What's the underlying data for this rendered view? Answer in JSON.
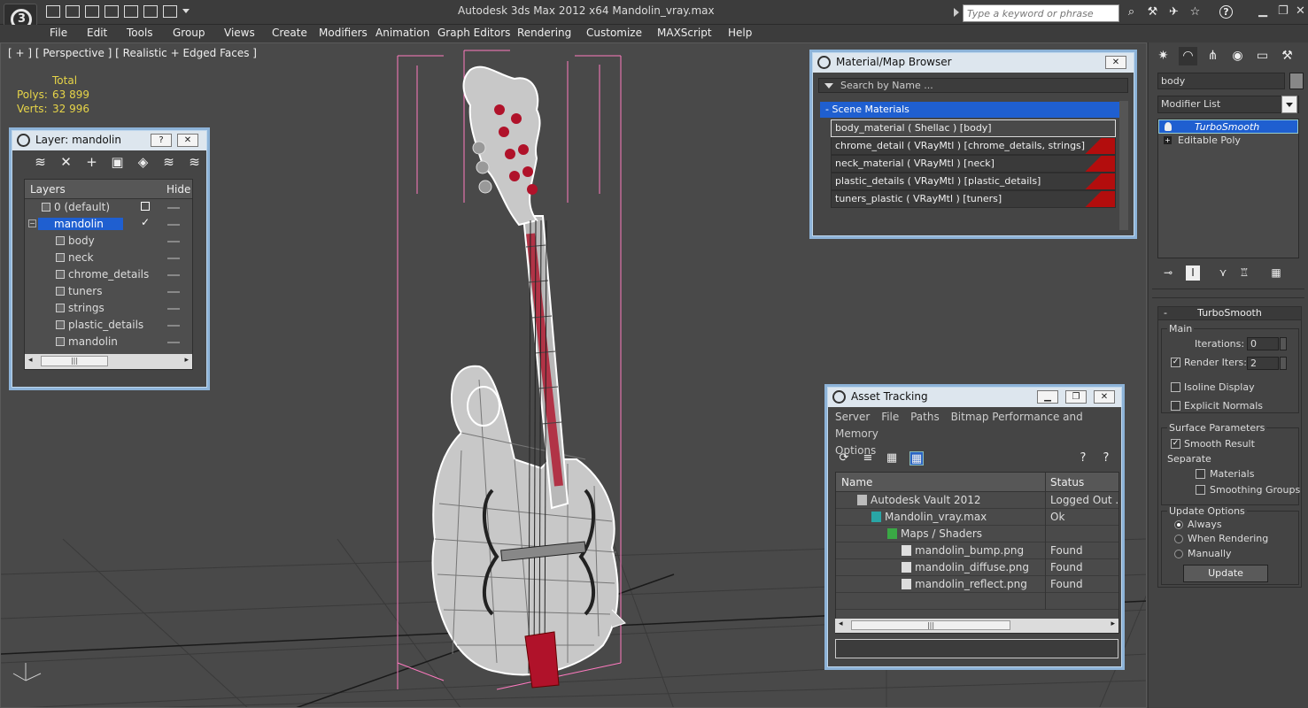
{
  "titlebar": {
    "title": "Autodesk 3ds Max  2012 x64      Mandolin_vray.max",
    "search_placeholder": "Type a keyword or phrase"
  },
  "menu": [
    "File",
    "Edit",
    "Tools",
    "Group",
    "Views",
    "Create",
    "Modifiers",
    "Animation",
    "Graph Editors",
    "Rendering",
    "Customize",
    "MAXScript",
    "Help"
  ],
  "viewport": {
    "label": "[ + ] [ Perspective ] [ Realistic + Edged Faces ]",
    "stats_header": "Total",
    "polys_label": "Polys:",
    "polys_value": "63 899",
    "verts_label": "Verts:",
    "verts_value": "32 996"
  },
  "layer_panel": {
    "title": "Layer: mandolin",
    "help_label": "?",
    "close_label": "✕",
    "col_layers": "Layers",
    "col_hide": "Hide",
    "rows": [
      {
        "name": "0 (default)",
        "level": 1
      },
      {
        "name": "mandolin",
        "level": 1
      },
      {
        "name": "body",
        "level": 2
      },
      {
        "name": "neck",
        "level": 2
      },
      {
        "name": "chrome_details",
        "level": 2
      },
      {
        "name": "tuners",
        "level": 2
      },
      {
        "name": "strings",
        "level": 2
      },
      {
        "name": "plastic_details",
        "level": 2
      },
      {
        "name": "mandolin",
        "level": 2
      }
    ]
  },
  "material_browser": {
    "title": "Material/Map Browser",
    "close_label": "✕",
    "search_placeholder": "Search by Name ...",
    "group": "-  Scene Materials",
    "materials": [
      "body_material  ( Shellac )  [body]",
      "chrome_detail  ( VRayMtl )  [chrome_details, strings]",
      "neck_material  ( VRayMtl )  [neck]",
      "plastic_details  ( VRayMtl )  [plastic_details]",
      "tuners_plastic  ( VRayMtl )  [tuners]"
    ],
    "swatch_color": "#b30d0d"
  },
  "asset_tracking": {
    "title": "Asset Tracking",
    "menu": [
      "Server",
      "File",
      "Paths",
      "Bitmap Performance and Memory",
      "Options"
    ],
    "col_name": "Name",
    "col_status": "Status",
    "rows": [
      {
        "name": "Autodesk Vault 2012",
        "status": "Logged Out ...",
        "indent": 1
      },
      {
        "name": "Mandolin_vray.max",
        "status": "Ok",
        "indent": 2
      },
      {
        "name": "Maps / Shaders",
        "status": "",
        "indent": 3
      },
      {
        "name": "mandolin_bump.png",
        "status": "Found",
        "indent": 4
      },
      {
        "name": "mandolin_diffuse.png",
        "status": "Found",
        "indent": 4
      },
      {
        "name": "mandolin_reflect.png",
        "status": "Found",
        "indent": 4
      }
    ]
  },
  "command_panel": {
    "object_name": "body",
    "modifier_list": "Modifier List",
    "stack": [
      "TurboSmooth",
      "Editable Poly"
    ],
    "rollout_title": "TurboSmooth",
    "main_label": "Main",
    "iterations_label": "Iterations:",
    "iterations_value": "0",
    "render_iters_label": "Render Iters:",
    "render_iters_value": "2",
    "isoline_label": "Isoline Display",
    "explicit_normals_label": "Explicit Normals",
    "surface_label": "Surface Parameters",
    "smooth_result_label": "Smooth Result",
    "separate_label": "Separate",
    "materials_label": "Materials",
    "smoothing_groups_label": "Smoothing Groups",
    "update_options_label": "Update Options",
    "always_label": "Always",
    "when_rendering_label": "When Rendering",
    "manually_label": "Manually",
    "update_button": "Update"
  },
  "colors": {
    "selection": "#1f5fd0",
    "wire": "#ffffff",
    "accent_wire": "#b0122a",
    "bbox": "#ff7ac0"
  }
}
